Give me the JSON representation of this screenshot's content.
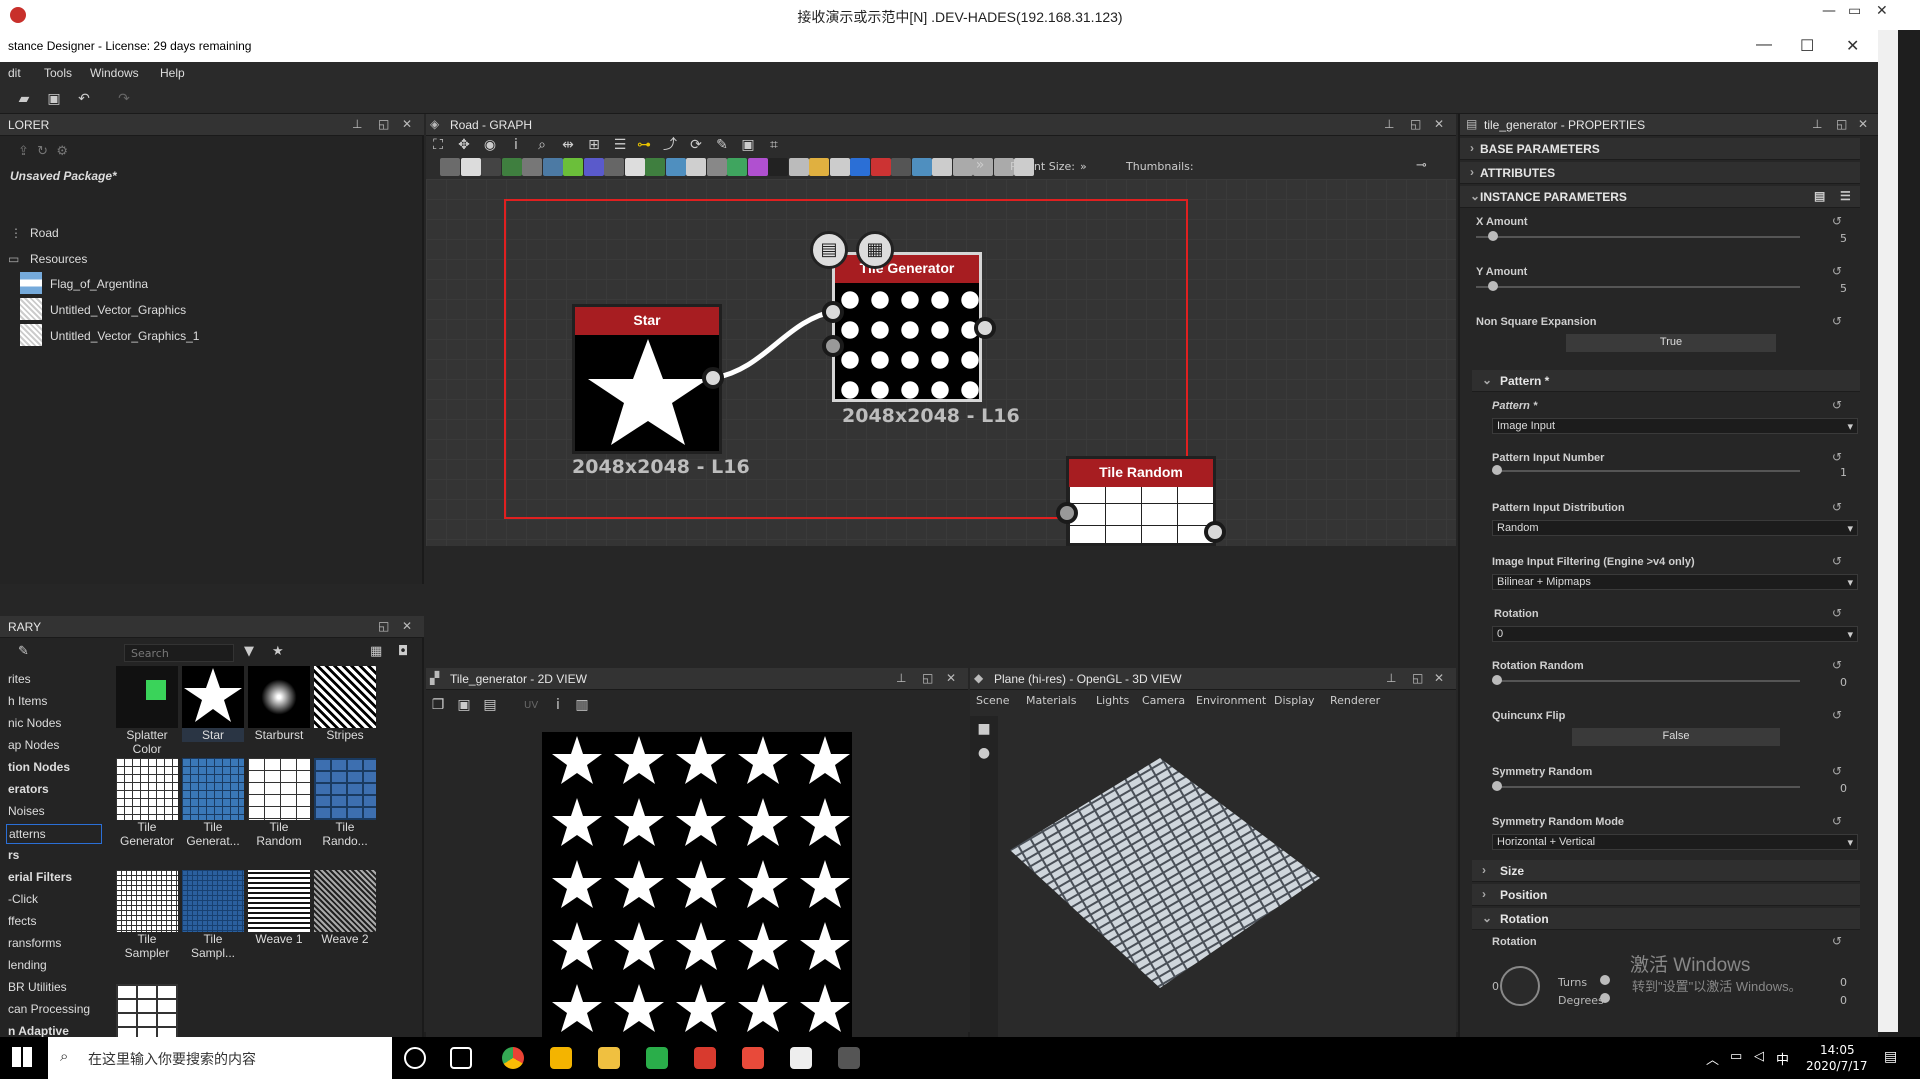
{
  "remote": {
    "title": "接收演示或示范中[N] .DEV-HADES(192.168.31.123)"
  },
  "app": {
    "title": "stance Designer - License: 29 days remaining"
  },
  "menu": [
    "dit",
    "Tools",
    "Windows",
    "Help"
  ],
  "explorer": {
    "title": "LORER",
    "package": "Unsaved Package*",
    "items": [
      "Road",
      "Resources",
      "Flag_of_Argentina",
      "Untitled_Vector_Graphics",
      "Untitled_Vector_Graphics_1"
    ]
  },
  "graph": {
    "title": "Road - GRAPH",
    "parent_size_label": "Parent Size:",
    "thumbnails_label": "Thumbnails:",
    "nodes": [
      {
        "name": "Star",
        "res": "2048x2048 - L16"
      },
      {
        "name": "Tile Generator",
        "res": "2048x2048 - L16"
      },
      {
        "name": "Tile Random"
      }
    ]
  },
  "library": {
    "title": "RARY",
    "search_placeholder": "Search",
    "categories": [
      "rites",
      "h Items",
      "nic Nodes",
      "ap Nodes",
      "tion Nodes",
      "erators",
      "Noises",
      "atterns",
      "rs",
      "erial Filters",
      "-Click",
      "ffects",
      "ransforms",
      "lending",
      "BR Utilities",
      "can Processing",
      "n Adaptive"
    ],
    "items": [
      "Splatter Color",
      "Star",
      "Starburst",
      "Stripes",
      "Tile Generator",
      "Tile Generat...",
      "Tile Random",
      "Tile Rando...",
      "Tile Sampler",
      "Tile Sampl...",
      "Weave 1",
      "Weave 2"
    ]
  },
  "view2d": {
    "title": "Tile_generator - 2D VIEW",
    "uv": "UV"
  },
  "view3d": {
    "title": "Plane (hi-res) - OpenGL - 3D VIEW",
    "menu": [
      "Scene",
      "Materials",
      "Lights",
      "Camera",
      "Environment",
      "Display",
      "Renderer"
    ]
  },
  "props": {
    "title": "tile_generator - PROPERTIES",
    "sections": [
      "BASE PARAMETERS",
      "ATTRIBUTES",
      "INSTANCE PARAMETERS"
    ],
    "x_amount": {
      "label": "X Amount",
      "value": "5"
    },
    "y_amount": {
      "label": "Y Amount",
      "value": "5"
    },
    "nse": {
      "label": "Non Square Expansion",
      "value": "True"
    },
    "pattern_group": "Pattern *",
    "pattern": {
      "label": "Pattern *",
      "value": "Image Input"
    },
    "pin": {
      "label": "Pattern Input Number",
      "value": "1"
    },
    "pid": {
      "label": "Pattern Input Distribution",
      "value": "Random"
    },
    "iif": {
      "label": "Image Input Filtering (Engine >v4 only)",
      "value": "Bilinear + Mipmaps"
    },
    "rotation": {
      "label": "Rotation",
      "value": "0"
    },
    "rot_random": {
      "label": "Rotation Random",
      "value": "0"
    },
    "quincunx": {
      "label": "Quincunx Flip",
      "value": "False"
    },
    "sym_random": {
      "label": "Symmetry Random",
      "value": "0"
    },
    "sym_mode": {
      "label": "Symmetry Random Mode",
      "value": "Horizontal + Vertical"
    },
    "groups": [
      "Size",
      "Position",
      "Rotation"
    ],
    "rot2": {
      "label": "Rotation",
      "dial": "0",
      "turns_label": "Turns",
      "turns": "0",
      "degrees_label": "Degrees",
      "degrees": "0"
    }
  },
  "watermark": {
    "line1": "激活 Windows",
    "line2": "转到\"设置\"以激活 Windows。"
  },
  "taskbar": {
    "search": "在这里输入你要搜索的内容",
    "time": "14:05",
    "date": "2020/7/17",
    "ime": "中"
  },
  "colors": {
    "node_header": "#a71d21",
    "selection": "#e02020",
    "accent": "#2b6fd6"
  }
}
